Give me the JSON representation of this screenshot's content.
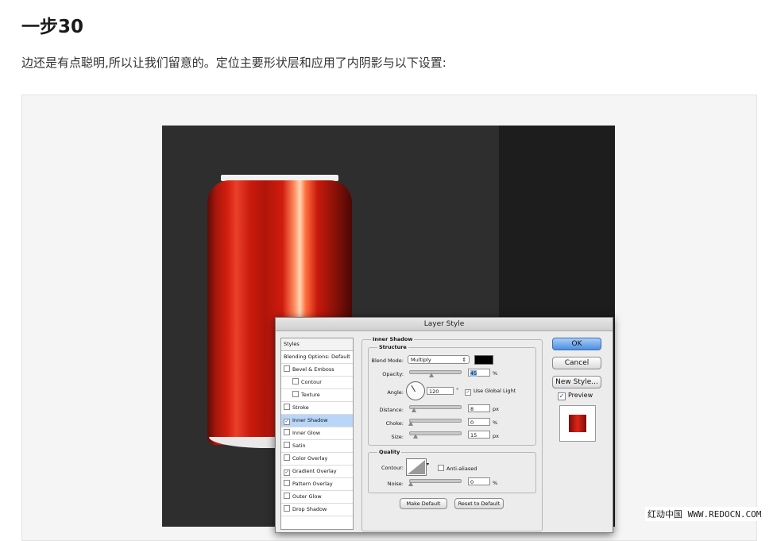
{
  "header": {
    "step_title": "一步30",
    "intro": "边还是有点聪明,所以让我们留意的。定位主要形状层和应用了内阴影与以下设置:"
  },
  "dialog": {
    "title": "Layer Style",
    "styles_panel": {
      "header": "Styles",
      "items": [
        {
          "label": "Blending Options: Default",
          "checkbox": false,
          "checked": false,
          "indent": false,
          "selected": false
        },
        {
          "label": "Bevel & Emboss",
          "checkbox": true,
          "checked": false,
          "indent": false,
          "selected": false
        },
        {
          "label": "Contour",
          "checkbox": true,
          "checked": false,
          "indent": true,
          "selected": false
        },
        {
          "label": "Texture",
          "checkbox": true,
          "checked": false,
          "indent": true,
          "selected": false
        },
        {
          "label": "Stroke",
          "checkbox": true,
          "checked": false,
          "indent": false,
          "selected": false
        },
        {
          "label": "Inner Shadow",
          "checkbox": true,
          "checked": true,
          "indent": false,
          "selected": true
        },
        {
          "label": "Inner Glow",
          "checkbox": true,
          "checked": false,
          "indent": false,
          "selected": false
        },
        {
          "label": "Satin",
          "checkbox": true,
          "checked": false,
          "indent": false,
          "selected": false
        },
        {
          "label": "Color Overlay",
          "checkbox": true,
          "checked": false,
          "indent": false,
          "selected": false
        },
        {
          "label": "Gradient Overlay",
          "checkbox": true,
          "checked": true,
          "indent": false,
          "selected": false
        },
        {
          "label": "Pattern Overlay",
          "checkbox": true,
          "checked": false,
          "indent": false,
          "selected": false
        },
        {
          "label": "Outer Glow",
          "checkbox": true,
          "checked": false,
          "indent": false,
          "selected": false
        },
        {
          "label": "Drop Shadow",
          "checkbox": true,
          "checked": false,
          "indent": false,
          "selected": false
        }
      ]
    },
    "inner_shadow": {
      "section_title": "Inner Shadow",
      "structure": {
        "title": "Structure",
        "blend_mode_label": "Blend Mode:",
        "blend_mode_value": "Multiply",
        "shadow_color": "#000000",
        "opacity_label": "Opacity:",
        "opacity_value": "45",
        "opacity_unit": "%",
        "angle_label": "Angle:",
        "angle_value": "120",
        "angle_unit": "°",
        "use_global_light_label": "Use Global Light",
        "use_global_light_checked": true,
        "distance_label": "Distance:",
        "distance_value": "8",
        "distance_unit": "px",
        "choke_label": "Choke:",
        "choke_value": "0",
        "choke_unit": "%",
        "size_label": "Size:",
        "size_value": "15",
        "size_unit": "px"
      },
      "quality": {
        "title": "Quality",
        "contour_label": "Contour:",
        "anti_aliased_label": "Anti-aliased",
        "anti_aliased_checked": false,
        "noise_label": "Noise:",
        "noise_value": "0",
        "noise_unit": "%"
      },
      "make_default_label": "Make Default",
      "reset_default_label": "Reset to Default"
    },
    "buttons": {
      "ok": "OK",
      "cancel": "Cancel",
      "new_style": "New Style...",
      "preview_label": "Preview",
      "preview_checked": true
    }
  },
  "watermark": "红动中国 WWW.REDOCN.COM",
  "colors": {
    "can_red": "#d4200f",
    "canvas_bg": "#2e2e2e",
    "selection_blue": "#b9d6f8"
  }
}
